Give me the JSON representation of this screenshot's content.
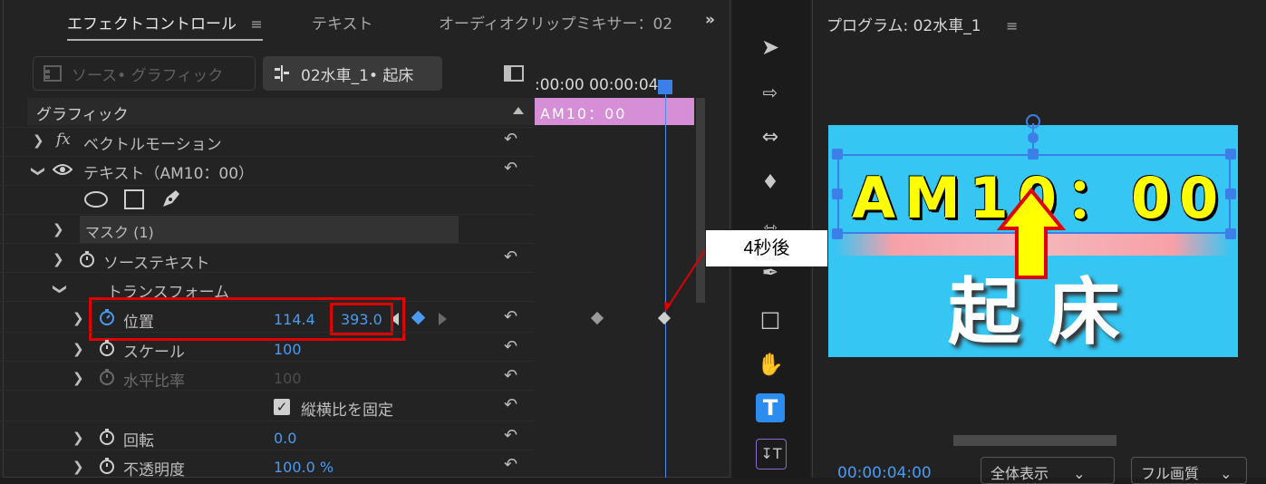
{
  "tabs": {
    "effect_controls": "エフェクトコントロール",
    "text": "テキスト",
    "audio_mixer": "オーディオクリップミキサー：02",
    "more": "»",
    "menu": "≡"
  },
  "breadcrumb": {
    "source": "ソース• グラフィック",
    "clip": "02水車_1• 起床"
  },
  "timeline": {
    "ruler": ":00:00 00:00:04",
    "clip_label": "AM10：00"
  },
  "effects": {
    "section": "グラフィック",
    "vector_motion": "ベクトルモーション",
    "fx": "fx",
    "text_layer": "テキスト（AM10：00）",
    "mask": "マスク (1)",
    "source_text": "ソーステキスト",
    "transform": "トランスフォーム",
    "position_label": "位置",
    "position_x": "114.4",
    "position_y": "393.0",
    "scale_label": "スケール",
    "scale_value": "100",
    "scale_width_label": "水平比率",
    "scale_width_value": "100",
    "uniform_scale_label": "縦横比を固定",
    "rotation_label": "回転",
    "rotation_value": "0.0",
    "opacity_label": "不透明度",
    "opacity_value": "100.0 %"
  },
  "callout": {
    "text": "4秒後"
  },
  "program": {
    "title": "プログラム: 02水車_1",
    "video_top_text": "AM10：00",
    "video_bottom_text": "起床",
    "timecode": "00:00:04:00",
    "fit_label": "全体表示",
    "quality_label": "フル画質"
  },
  "colors": {
    "accent": "#4a9bf0",
    "highlight_red": "#e00000",
    "clip_pink": "#d68ed6",
    "video_bg": "#35c6f4",
    "arrow_yellow": "#ffff00"
  },
  "icons": {
    "source_graphic": "film-icon",
    "clip": "sequence-icon",
    "collapse": "collapse-panel-icon",
    "reset": "reset-icon",
    "stopwatch": "stopwatch-icon",
    "eye": "eye-icon",
    "ellipse": "ellipse-mask-icon",
    "rectangle": "rectangle-mask-icon",
    "pen": "pen-mask-icon",
    "keyframe": "keyframe-diamond-icon"
  }
}
